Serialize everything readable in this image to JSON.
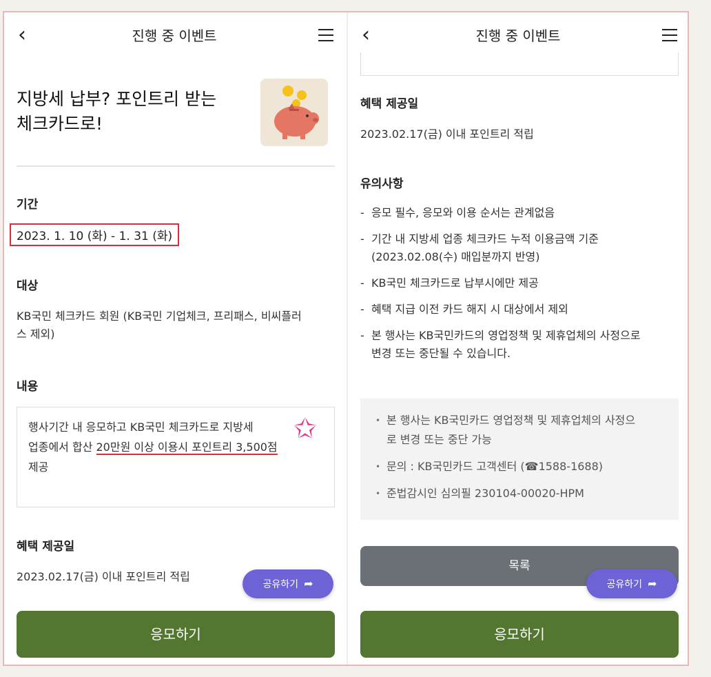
{
  "left": {
    "header": {
      "title": "진행 중 이벤트"
    },
    "event_title": "지방세 납부? 포인트리 받는 체크카드로!",
    "period": {
      "label": "기간",
      "value": "2023. 1. 10 (화) - 1. 31 (화)"
    },
    "target": {
      "label": "대상",
      "value": "KB국민 체크카드 회원 (KB국민 기업체크, 프리패스, 비씨플러스 제외)"
    },
    "content": {
      "label": "내용",
      "text_1": "행사기간 내 응모하고 KB국민 체크카드로 지방세",
      "text_2a": "업종에서 합산 ",
      "text_2b": "20만원 이상 이용시 포인트리 3,500점",
      "text_3": "제공"
    },
    "benefit": {
      "label": "혜택 제공일",
      "value": "2023.02.17(금) 이내 포인트리 적립"
    },
    "share_label": "공유하기",
    "apply_label": "응모하기"
  },
  "right": {
    "header": {
      "title": "진행 중 이벤트"
    },
    "benefit": {
      "label": "혜택 제공일",
      "value": "2023.02.17(금) 이내 포인트리 적립"
    },
    "precautions": {
      "label": "유의사항",
      "items": [
        "응모 필수, 응모와 이용 순서는 관계없음",
        "기간 내 지방세 업종 체크카드 누적 이용금액 기준 (2023.02.08(수) 매입분까지 반영)",
        "KB국민 체크카드로 납부시에만 제공",
        "혜택 지급 이전 카드 해지 시 대상에서 제외",
        "본 행사는 KB국민카드의 영업정책 및 제휴업체의 사정으로 변경 또는 중단될 수 있습니다."
      ]
    },
    "notice": [
      "본 행사는 KB국민카드 영업정책 및 제휴업체의 사정으로 변경 또는 중단 가능",
      "문의 : KB국민카드 고객센터 (☎1588-1688)",
      "준법감시인 심의필 230104-00020-HPM"
    ],
    "list_label": "목록",
    "share_label": "공유하기",
    "apply_label": "응모하기"
  },
  "colors": {
    "apply": "#537631",
    "share": "#6d62d6",
    "list": "#6b7076",
    "highlight": "#d5303a"
  },
  "icons": {
    "back": "chevron-left-icon",
    "menu": "hamburger-menu-icon",
    "share": "share-arrow-icon",
    "event": "piggy-bank-icon"
  }
}
